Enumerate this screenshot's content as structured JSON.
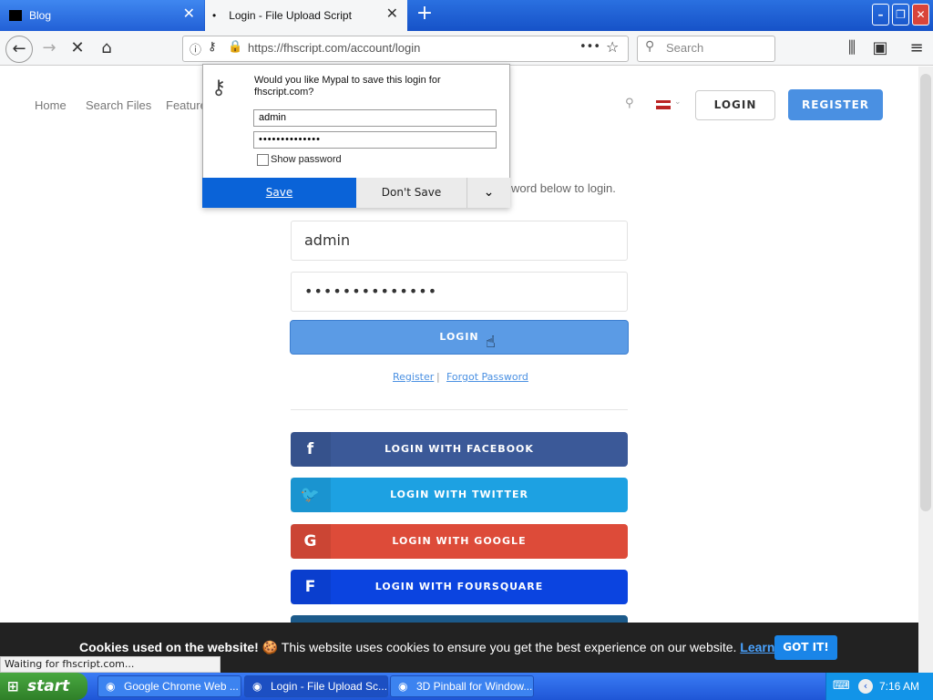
{
  "tabs": [
    {
      "label": "Blog"
    },
    {
      "label": "Login - File Upload Script"
    }
  ],
  "window_controls": {
    "minimize": "–",
    "restore": "❐",
    "close": "✕"
  },
  "toolbar": {
    "url": "https://fhscript.com/account/login",
    "search_placeholder": "Search"
  },
  "site_nav": {
    "home": "Home",
    "search_files": "Search Files",
    "features": "Features",
    "login": "LOGIN",
    "register": "REGISTER"
  },
  "login_form": {
    "intro": "word below to login.",
    "username": "admin",
    "password": "••••••••••••••",
    "submit": "LOGIN",
    "register_link": "Register",
    "separator": "|",
    "forgot_link": "Forgot Password"
  },
  "social": [
    {
      "label": "LOGIN WITH FACEBOOK",
      "icon": "f",
      "color": "#3b5998"
    },
    {
      "label": "LOGIN WITH TWITTER",
      "icon": "🐦",
      "color": "#1da1e2"
    },
    {
      "label": "LOGIN WITH GOOGLE",
      "icon": "G",
      "color": "#dd4b39"
    },
    {
      "label": "LOGIN WITH FOURSQUARE",
      "icon": "F",
      "color": "#0b44e0"
    }
  ],
  "password_popup": {
    "prompt": "Would you like Mypal to save this login for fhscript.com?",
    "username": "admin",
    "password": "••••••••••••••",
    "show_password": "Show password",
    "save": "Save",
    "dont_save": "Don't Save"
  },
  "cookie": {
    "bold": "Cookies used on the website!",
    "text": " 🍪 This website uses cookies to ensure you get the best experience on our website. ",
    "learn_more": "Learn more",
    "got_it": "GOT IT!"
  },
  "status": "Waiting for fhscript.com...",
  "taskbar": {
    "start": "start",
    "tasks": [
      "Google Chrome Web ...",
      "Login - File Upload Sc...",
      "3D Pinball for Window..."
    ],
    "clock": "7:16 AM"
  }
}
